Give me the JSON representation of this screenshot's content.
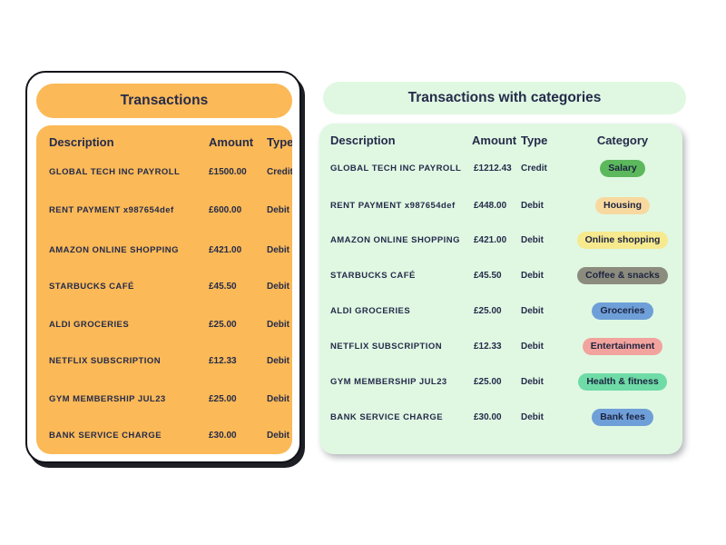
{
  "page": {
    "background": "#ffffff"
  },
  "left_card": {
    "name": "transactions-card",
    "title": "Transactions",
    "header_bg": "#fbb957",
    "panel_bg": "#fbb957",
    "frame_bg": "#ffffff",
    "text_color": "#252b4a",
    "columns": [
      "Description",
      "Amount",
      "Type"
    ],
    "rows": [
      {
        "description": "GLOBAL TECH INC PAYROLL",
        "amount": "£1500.00",
        "type": "Credit"
      },
      {
        "description": "RENT PAYMENT x987654def",
        "amount": "£600.00",
        "type": "Debit"
      },
      {
        "description": "AMAZON ONLINE SHOPPING",
        "amount": "£421.00",
        "type": "Debit"
      },
      {
        "description": "STARBUCKS CAFÉ",
        "amount": "£45.50",
        "type": "Debit"
      },
      {
        "description": "ALDI GROCERIES",
        "amount": "£25.00",
        "type": "Debit"
      },
      {
        "description": "NETFLIX SUBSCRIPTION",
        "amount": "£12.33",
        "type": "Debit"
      },
      {
        "description": "GYM MEMBERSHIP JUL23",
        "amount": "£25.00",
        "type": "Debit"
      },
      {
        "description": "BANK SERVICE CHARGE",
        "amount": "£30.00",
        "type": "Debit"
      }
    ]
  },
  "right_card": {
    "name": "transactions-with-categories-card",
    "title": "Transactions with categories",
    "header_bg": "#e0f8e2",
    "panel_bg": "#e0f8e2",
    "text_color": "#252b4a",
    "columns": [
      "Description",
      "Amount",
      "Type",
      "Category"
    ],
    "rows": [
      {
        "description": "GLOBAL TECH INC PAYROLL",
        "amount": "£1212.43",
        "type": "Credit",
        "category": "Salary",
        "category_color": "#5cb85c"
      },
      {
        "description": "RENT PAYMENT x987654def",
        "amount": "£448.00",
        "type": "Debit",
        "category": "Housing",
        "category_color": "#f7d9a0"
      },
      {
        "description": "AMAZON ONLINE SHOPPING",
        "amount": "£421.00",
        "type": "Debit",
        "category": "Online shopping",
        "category_color": "#f6e98e"
      },
      {
        "description": "STARBUCKS CAFÉ",
        "amount": "£45.50",
        "type": "Debit",
        "category": "Coffee & snacks",
        "category_color": "#8c8c7e"
      },
      {
        "description": "ALDI GROCERIES",
        "amount": "£25.00",
        "type": "Debit",
        "category": "Groceries",
        "category_color": "#6f9fd8"
      },
      {
        "description": "NETFLIX SUBSCRIPTION",
        "amount": "£12.33",
        "type": "Debit",
        "category": "Entertainment",
        "category_color": "#f2a39d"
      },
      {
        "description": "GYM MEMBERSHIP JUL23",
        "amount": "£25.00",
        "type": "Debit",
        "category": "Health & fitness",
        "category_color": "#6fdba6"
      },
      {
        "description": "BANK SERVICE CHARGE",
        "amount": "£30.00",
        "type": "Debit",
        "category": "Bank fees",
        "category_color": "#6f9fd8"
      }
    ]
  }
}
